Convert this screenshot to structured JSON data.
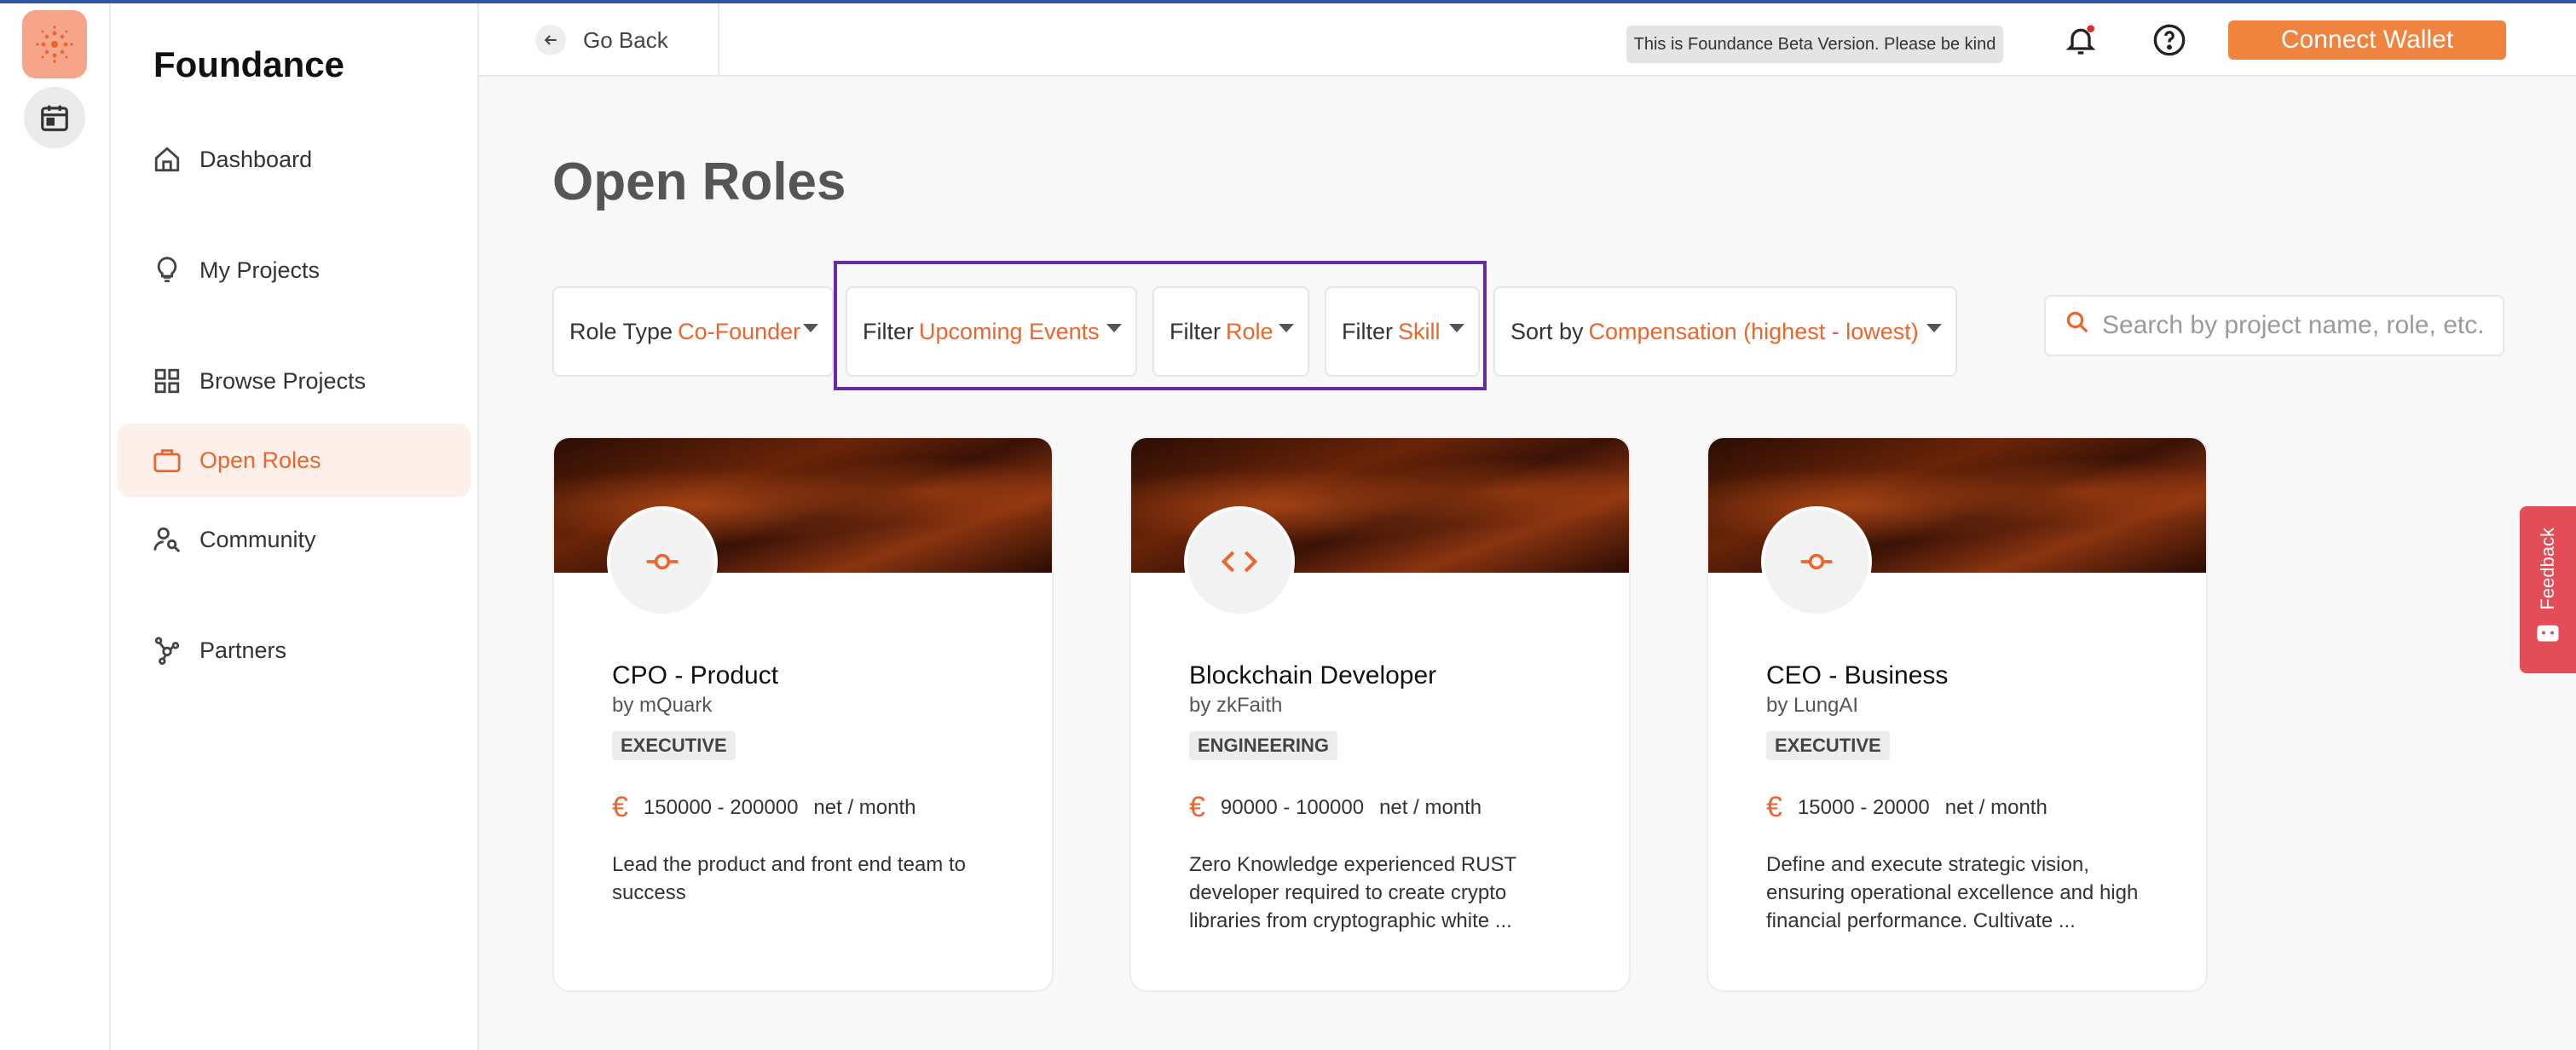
{
  "app": {
    "brand": "Foundance"
  },
  "nav": {
    "items": [
      {
        "label": "Dashboard",
        "icon": "home-icon"
      },
      {
        "label": "My Projects",
        "icon": "lightbulb-icon"
      },
      {
        "label": "Browse Projects",
        "icon": "grid-icon"
      },
      {
        "label": "Open Roles",
        "icon": "briefcase-icon",
        "active": true
      },
      {
        "label": "Community",
        "icon": "people-search-icon"
      },
      {
        "label": "Partners",
        "icon": "hub-icon"
      }
    ]
  },
  "topbar": {
    "go_back": "Go Back",
    "beta_notice": "This is Foundance Beta Version. Please be kind",
    "connect_wallet": "Connect Wallet"
  },
  "page": {
    "title": "Open Roles"
  },
  "filters": {
    "role_type": {
      "label": "Role Type",
      "value": "Co-Founder"
    },
    "events": {
      "label": "Filter",
      "value": "Upcoming Events"
    },
    "role": {
      "label": "Filter",
      "value": "Role"
    },
    "skill": {
      "label": "Filter",
      "value": "Skill"
    },
    "sort": {
      "label": "Sort by",
      "value": "Compensation (highest - lowest)"
    }
  },
  "search": {
    "placeholder": "Search by project name, role, etc."
  },
  "cards": [
    {
      "title": "CPO - Product",
      "by": "by mQuark",
      "tag": "EXECUTIVE",
      "currency": "€",
      "range": "150000 - 200000",
      "unit": "net / month",
      "description": "Lead the product and front end team to success",
      "icon": "commit-icon"
    },
    {
      "title": "Blockchain Developer",
      "by": "by zkFaith",
      "tag": "ENGINEERING",
      "currency": "€",
      "range": "90000 - 100000",
      "unit": "net / month",
      "description": "Zero Knowledge experienced RUST developer required to create crypto libraries from cryptographic white ...",
      "icon": "code-icon"
    },
    {
      "title": "CEO - Business",
      "by": "by LungAI",
      "tag": "EXECUTIVE",
      "currency": "€",
      "range": "15000 - 20000",
      "unit": "net / month",
      "description": "Define and execute strategic vision, ensuring operational excellence and high financial performance. Cultivate ...",
      "icon": "commit-icon"
    }
  ],
  "feedback": {
    "label": "Feedback"
  },
  "colors": {
    "accent": "#e9662c",
    "wallet": "#f0843e",
    "highlight": "#6a2aa0",
    "feedback": "#e24d57"
  }
}
